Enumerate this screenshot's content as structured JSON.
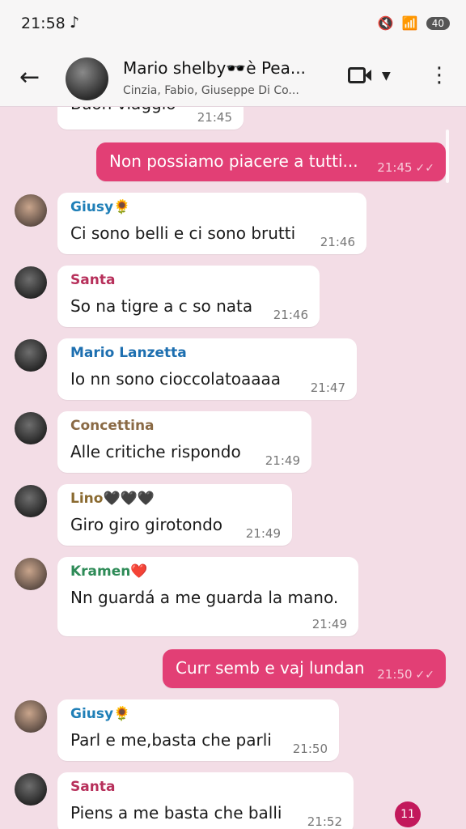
{
  "status": {
    "time": "21:58",
    "app_logo": "♪",
    "battery": "40"
  },
  "header": {
    "title": "Mario shelby🕶️è Pea...",
    "subtitle": "Cinzia, Fabio, Giuseppe Di Co..."
  },
  "messages": [
    {
      "type": "in",
      "text": "Buon viaggio",
      "time": "21:45"
    },
    {
      "type": "out",
      "text": "Non possiamo piacere a tutti...",
      "time": "21:45"
    },
    {
      "type": "in",
      "sender": "Giusy🌻",
      "color": "#1f7fb7",
      "text": "Ci sono belli e ci sono brutti",
      "time": "21:46"
    },
    {
      "type": "in",
      "sender": "Santa",
      "color": "#b7305b",
      "text": "So na tigre a c so nata",
      "time": "21:46"
    },
    {
      "type": "in",
      "sender": "Mario Lanzetta",
      "color": "#1d6fb0",
      "text": "Io nn sono cioccolatoaaaa",
      "time": "21:47"
    },
    {
      "type": "in",
      "sender": "Concettina",
      "color": "#8a6a45",
      "text": "Alle critiche rispondo",
      "time": "21:49"
    },
    {
      "type": "in",
      "sender": "Lino🖤🖤🖤",
      "color": "#8a6a30",
      "text": "Giro giro girotondo",
      "time": "21:49"
    },
    {
      "type": "in",
      "sender": "Kramen❤️",
      "color": "#2e8b57",
      "text": "Nn guardá a me guarda la mano.",
      "time": "21:49"
    },
    {
      "type": "out",
      "text": "Curr semb e vaj lundan",
      "time": "21:50"
    },
    {
      "type": "in",
      "sender": "Giusy🌻",
      "color": "#1f7fb7",
      "text": "Parl e me,basta che parli",
      "time": "21:50"
    },
    {
      "type": "in",
      "sender": "Santa",
      "color": "#b7305b",
      "text": "Piens a me basta che balli",
      "time": "21:52"
    }
  ],
  "unread_count": "11",
  "colors": {
    "outgoing": "#e23f75",
    "background": "#f3dde6"
  },
  "icons": [
    "back-arrow-icon",
    "video-call-icon",
    "chevron-down-icon",
    "more-vert-icon",
    "double-check-icon"
  ]
}
